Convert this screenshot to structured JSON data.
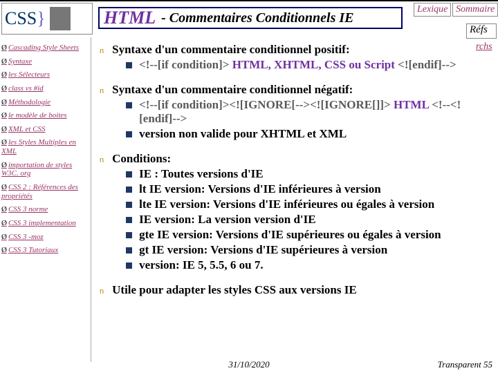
{
  "logo_text": "CSS",
  "title_html": "HTML",
  "title_rest": " - Commentaires Conditionnels IE",
  "top_links": {
    "lexique": "Lexique",
    "sommaire": "Sommaire"
  },
  "refs": "Réfs",
  "rchs": "rchs",
  "sidebar": [
    "Cascading Style Sheets",
    "Syntaxe",
    "les Sélecteurs",
    "class vs #id",
    "Méthodologie",
    "le modèle de boites",
    "XML et CSS",
    "les Styles Multiples en XML",
    "importation de styles W3C. org",
    "CSS 2 : Références des propriétés",
    "CSS 3 norme",
    "CSS 3 implementation",
    "CSS 3 -moz",
    "CSS 3 Tutoriaux"
  ],
  "sec1": {
    "head": "Syntaxe d'un commentaire conditionnel positif:",
    "line_a": "<!--[if condition]>",
    "line_b": " HTML, XHTML, CSS ou Script ",
    "line_c": "<![endif]-->"
  },
  "sec2": {
    "head": "Syntaxe d'un commentaire conditionnel négatif:",
    "l1a": "<!--[if condition]><![IGNORE[--><![IGNORE[]]>",
    "l1b": " HTML ",
    "l1c": "<!--<![endif]-->",
    "l2": "version non valide pour XHTML et XML"
  },
  "sec3": {
    "head": "Conditions:",
    "items": [
      "IE : Toutes versions d'IE",
      "lt IE version: Versions d'IE inférieures à version",
      "lte IE version: Versions d'IE inférieures ou égales à version",
      "IE version: La version version d'IE",
      "gte IE version: Versions d'IE supérieures ou égales à version",
      "gt IE version: Versions d'IE supérieures à version",
      "version: IE 5, 5.5, 6 ou 7."
    ]
  },
  "sec4": "Utile pour adapter les styles CSS aux versions IE",
  "footer": {
    "date": "31/10/2020",
    "page": "Transparent 55"
  }
}
